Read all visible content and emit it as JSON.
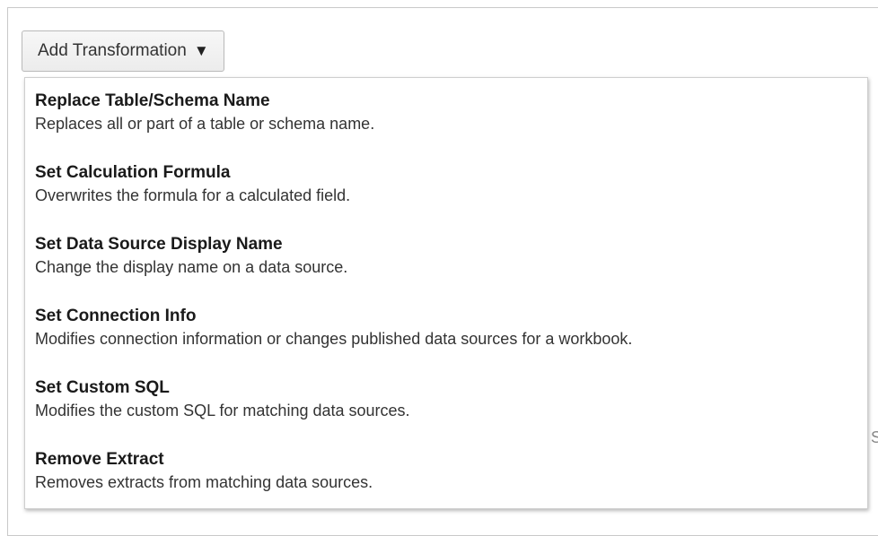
{
  "add_button": {
    "label": "Add Transformation",
    "caret": "▼",
    "icon": "caret-down-icon"
  },
  "menu": {
    "items": [
      {
        "title": "Replace Table/Schema Name",
        "description": "Replaces all or part of a table or schema name."
      },
      {
        "title": "Set Calculation Formula",
        "description": "Overwrites the formula for a calculated field."
      },
      {
        "title": "Set Data Source Display Name",
        "description": "Change the display name on a data source."
      },
      {
        "title": "Set Connection Info",
        "description": "Modifies connection information or changes published data sources for a workbook."
      },
      {
        "title": "Set Custom SQL",
        "description": "Modifies the custom SQL for matching data sources."
      },
      {
        "title": "Remove Extract",
        "description": "Removes extracts from matching data sources."
      }
    ]
  },
  "background_partial_text": "S"
}
